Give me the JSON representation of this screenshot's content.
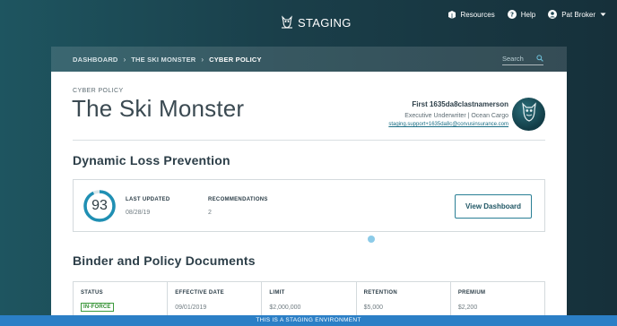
{
  "header": {
    "logo_text": "STAGING",
    "nav": [
      {
        "icon": "resources-icon",
        "label": "Resources"
      },
      {
        "icon": "help-icon",
        "label": "Help"
      },
      {
        "icon": "user-icon",
        "label": "Pat Broker"
      }
    ]
  },
  "breadcrumb": {
    "items": [
      "DASHBOARD",
      "THE SKI MONSTER",
      "CYBER POLICY"
    ],
    "search_placeholder": "Search"
  },
  "policy": {
    "type_label": "CYBER POLICY",
    "title": "The Ski Monster",
    "underwriter": {
      "name": "First 1635da8clastnamerson",
      "title": "Executive Underwriter | Ocean Cargo",
      "email": "staging.support+1635da8c@corvusinsurance.com"
    }
  },
  "dlp": {
    "section_title": "Dynamic Loss Prevention",
    "score": "93",
    "score_fraction": 0.93,
    "last_updated_label": "LAST UPDATED",
    "last_updated_value": "08/28/19",
    "recommendations_label": "RECOMMENDATIONS",
    "recommendations_value": "2",
    "button_label": "View Dashboard",
    "accent_color": "#1f8fb3"
  },
  "docs": {
    "section_title": "Binder and Policy Documents",
    "columns": [
      {
        "header": "STATUS",
        "value": "IN-FORCE"
      },
      {
        "header": "EFFECTIVE DATE",
        "value": "09/01/2019"
      },
      {
        "header": "LIMIT",
        "value": "$2,000,000"
      },
      {
        "header": "RETENTION",
        "value": "$5,000"
      },
      {
        "header": "PREMIUM",
        "value": "$2,200"
      }
    ]
  },
  "banner": {
    "text": "THIS IS A STAGING ENVIRONMENT",
    "color": "#2b7fc6"
  }
}
